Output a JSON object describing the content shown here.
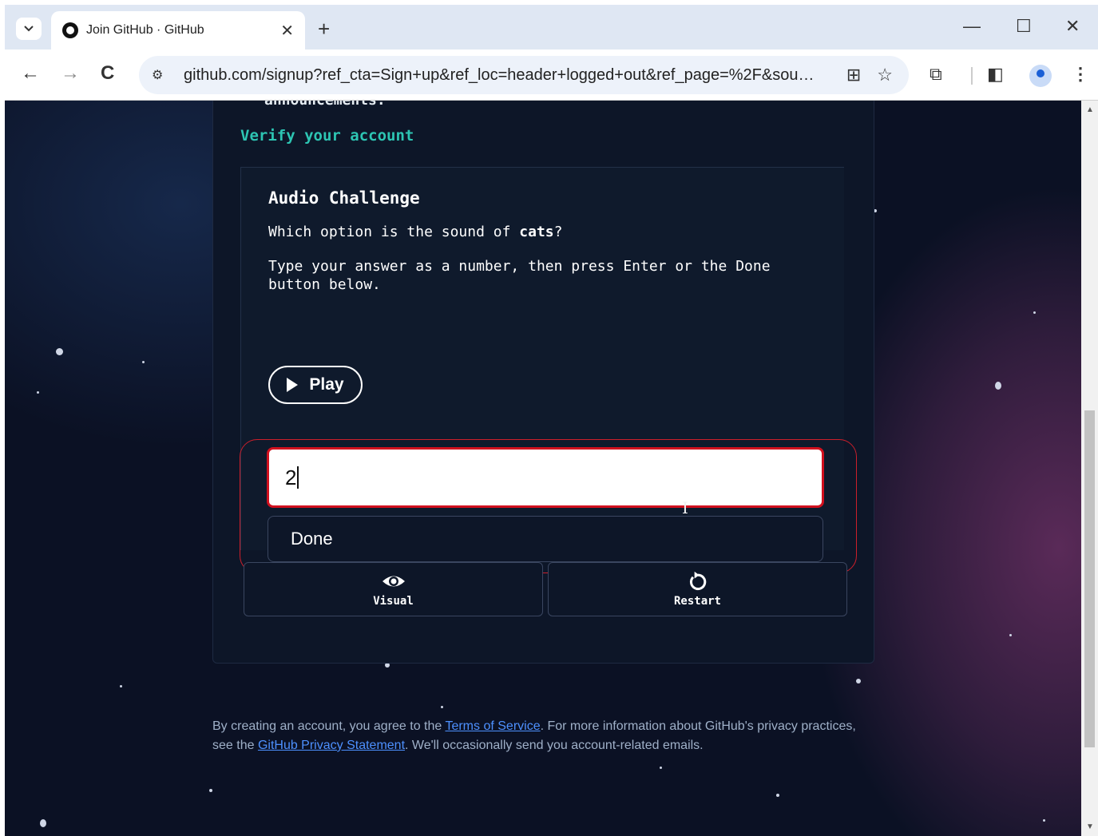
{
  "browser": {
    "tab_title": "Join GitHub · GitHub",
    "url": "github.com/signup?ref_cta=Sign+up&ref_loc=header+logged+out&ref_page=%2F&sou…",
    "icons": {
      "tab_menu": "chevron-down",
      "new_tab": "+",
      "minimize": "—",
      "maximize": "☐",
      "close": "✕",
      "back": "←",
      "forward": "→",
      "reload": "C",
      "site_info": "⚙",
      "install": "⊞",
      "bookmark": "☆",
      "extensions": "⧉",
      "sidepanel": "◧",
      "menu": "⋮"
    }
  },
  "page": {
    "cut_text": "announcements.",
    "verify_title": "Verify your account",
    "challenge": {
      "title": "Audio Challenge",
      "question_prefix": "Which option is the sound of ",
      "question_bold": "cats",
      "question_suffix": "?",
      "instructions": "Type your answer as a number, then press Enter or the Done button below.",
      "play_label": "Play",
      "answer_value": "2",
      "done_label": "Done",
      "visual_label": "Visual",
      "restart_label": "Restart"
    },
    "terms": {
      "part1": "By creating an account, you agree to the ",
      "tos_link": "Terms of Service",
      "part2": ". For more information about GitHub's privacy practices, see the ",
      "privacy_link": "GitHub Privacy Statement",
      "part3": ". We'll occasionally send you account-related emails."
    }
  },
  "colors": {
    "accent_teal": "#2dc5b3",
    "error_red": "#d1101e",
    "link_blue": "#4d90fe",
    "page_bg": "#0b1124"
  }
}
